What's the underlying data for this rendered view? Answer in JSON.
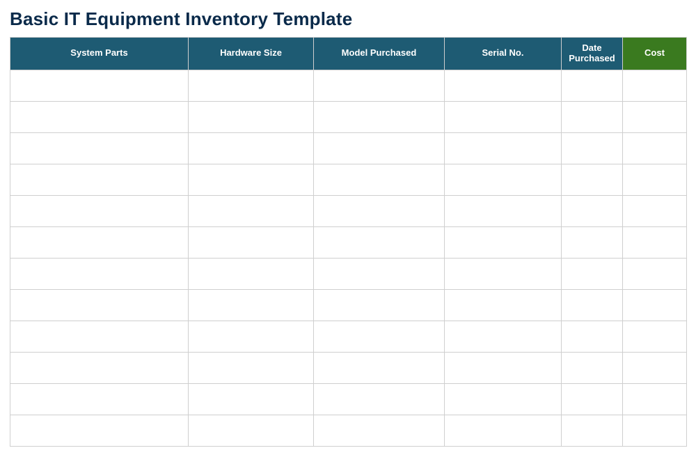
{
  "title": "Basic IT Equipment Inventory Template",
  "columns": [
    {
      "label": "System Parts",
      "color": "teal"
    },
    {
      "label": "Hardware Size",
      "color": "teal"
    },
    {
      "label": "Model Purchased",
      "color": "teal"
    },
    {
      "label": "Serial No.",
      "color": "teal"
    },
    {
      "label": "Date Purchased",
      "color": "teal"
    },
    {
      "label": "Cost",
      "color": "green"
    }
  ],
  "rows": [
    {
      "system_parts": "",
      "hardware_size": "",
      "model_purchased": "",
      "serial_no": "",
      "date_purchased": "",
      "cost": ""
    },
    {
      "system_parts": "",
      "hardware_size": "",
      "model_purchased": "",
      "serial_no": "",
      "date_purchased": "",
      "cost": ""
    },
    {
      "system_parts": "",
      "hardware_size": "",
      "model_purchased": "",
      "serial_no": "",
      "date_purchased": "",
      "cost": ""
    },
    {
      "system_parts": "",
      "hardware_size": "",
      "model_purchased": "",
      "serial_no": "",
      "date_purchased": "",
      "cost": ""
    },
    {
      "system_parts": "",
      "hardware_size": "",
      "model_purchased": "",
      "serial_no": "",
      "date_purchased": "",
      "cost": ""
    },
    {
      "system_parts": "",
      "hardware_size": "",
      "model_purchased": "",
      "serial_no": "",
      "date_purchased": "",
      "cost": ""
    },
    {
      "system_parts": "",
      "hardware_size": "",
      "model_purchased": "",
      "serial_no": "",
      "date_purchased": "",
      "cost": ""
    },
    {
      "system_parts": "",
      "hardware_size": "",
      "model_purchased": "",
      "serial_no": "",
      "date_purchased": "",
      "cost": ""
    },
    {
      "system_parts": "",
      "hardware_size": "",
      "model_purchased": "",
      "serial_no": "",
      "date_purchased": "",
      "cost": ""
    },
    {
      "system_parts": "",
      "hardware_size": "",
      "model_purchased": "",
      "serial_no": "",
      "date_purchased": "",
      "cost": ""
    },
    {
      "system_parts": "",
      "hardware_size": "",
      "model_purchased": "",
      "serial_no": "",
      "date_purchased": "",
      "cost": ""
    },
    {
      "system_parts": "",
      "hardware_size": "",
      "model_purchased": "",
      "serial_no": "",
      "date_purchased": "",
      "cost": ""
    }
  ],
  "colors": {
    "teal": "#1e5b73",
    "green": "#3a7a1f",
    "title": "#0a2a4a",
    "grid": "#cfcfcf"
  }
}
